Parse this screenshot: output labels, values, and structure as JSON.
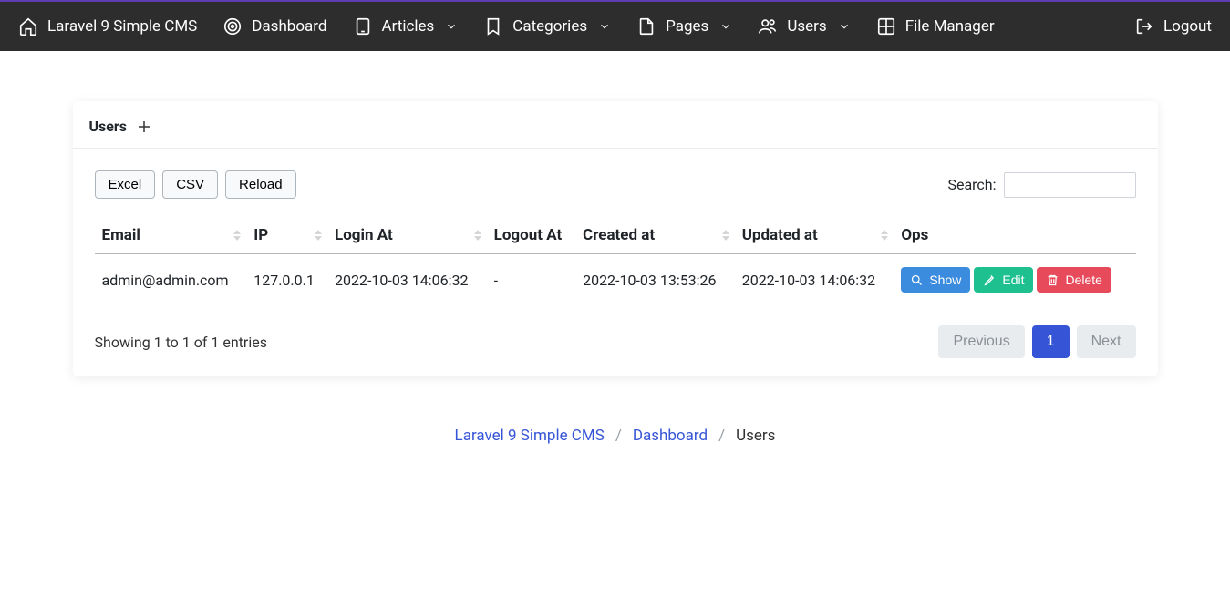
{
  "nav": {
    "brand": "Laravel 9 Simple CMS",
    "dashboard": "Dashboard",
    "articles": "Articles",
    "categories": "Categories",
    "pages": "Pages",
    "users": "Users",
    "file_manager": "File Manager",
    "logout": "Logout"
  },
  "card": {
    "title": "Users"
  },
  "toolbar": {
    "excel": "Excel",
    "csv": "CSV",
    "reload": "Reload",
    "search_label": "Search:"
  },
  "table": {
    "headers": {
      "email": "Email",
      "ip": "IP",
      "login_at": "Login At",
      "logout_at": "Logout At",
      "created_at": "Created at",
      "updated_at": "Updated at",
      "ops": "Ops"
    },
    "rows": [
      {
        "email": "admin@admin.com",
        "ip": "127.0.0.1",
        "login_at": "2022-10-03 14:06:32",
        "logout_at": "-",
        "created_at": "2022-10-03 13:53:26",
        "updated_at": "2022-10-03 14:06:32"
      }
    ],
    "ops": {
      "show": "Show",
      "edit": "Edit",
      "delete": "Delete"
    }
  },
  "footer": {
    "entries": "Showing 1 to 1 of 1 entries",
    "previous": "Previous",
    "page1": "1",
    "next": "Next"
  },
  "breadcrumb": {
    "home": "Laravel 9 Simple CMS",
    "dashboard": "Dashboard",
    "current": "Users",
    "sep": "/"
  }
}
